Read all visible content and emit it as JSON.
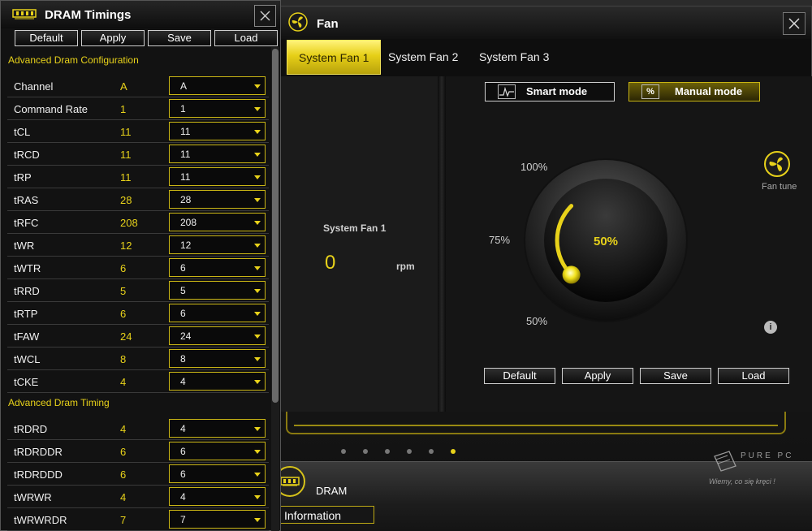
{
  "dram_window": {
    "title": "DRAM Timings",
    "buttons": {
      "default": "Default",
      "apply": "Apply",
      "save": "Save",
      "load": "Load"
    },
    "section_config": "Advanced Dram Configuration",
    "section_timing": "Advanced Dram Timing",
    "config_rows": [
      {
        "name": "Channel",
        "value": "A",
        "selected": "A"
      },
      {
        "name": "Command Rate",
        "value": "1",
        "selected": "1"
      },
      {
        "name": "tCL",
        "value": "11",
        "selected": "11"
      },
      {
        "name": "tRCD",
        "value": "11",
        "selected": "11"
      },
      {
        "name": "tRP",
        "value": "11",
        "selected": "11"
      },
      {
        "name": "tRAS",
        "value": "28",
        "selected": "28"
      },
      {
        "name": "tRFC",
        "value": "208",
        "selected": "208"
      },
      {
        "name": "tWR",
        "value": "12",
        "selected": "12"
      },
      {
        "name": "tWTR",
        "value": "6",
        "selected": "6"
      },
      {
        "name": "tRRD",
        "value": "5",
        "selected": "5"
      },
      {
        "name": "tRTP",
        "value": "6",
        "selected": "6"
      },
      {
        "name": "tFAW",
        "value": "24",
        "selected": "24"
      },
      {
        "name": "tWCL",
        "value": "8",
        "selected": "8"
      },
      {
        "name": "tCKE",
        "value": "4",
        "selected": "4"
      }
    ],
    "timing_rows": [
      {
        "name": "tRDRD",
        "value": "4",
        "selected": "4"
      },
      {
        "name": "tRDRDDR",
        "value": "6",
        "selected": "6"
      },
      {
        "name": "tRDRDDD",
        "value": "6",
        "selected": "6"
      },
      {
        "name": "tWRWR",
        "value": "4",
        "selected": "4"
      },
      {
        "name": "tWRWRDR",
        "value": "7",
        "selected": "7"
      }
    ]
  },
  "fan_window": {
    "title": "Fan",
    "tabs": [
      "System Fan 1",
      "System Fan 2",
      "System Fan 3"
    ],
    "active_tab": 0,
    "fan_name": "System Fan 1",
    "rpm_value": "0",
    "rpm_unit": "rpm",
    "modes": {
      "smart": "Smart mode",
      "manual": "Manual mode",
      "manual_icon": "%"
    },
    "active_mode": "manual",
    "fan_tune_label": "Fan tune",
    "info_icon": "i",
    "dial": {
      "value_label": "50%",
      "tick_100": "100%",
      "tick_75": "75%",
      "tick_50": "50%",
      "level_percent": 50
    },
    "buttons": {
      "default": "Default",
      "apply": "Apply",
      "save": "Save",
      "load": "Load"
    }
  },
  "background": {
    "dram_tile_label": "DRAM",
    "info_tab_label": "Information",
    "pager_dot_count": 6,
    "pager_active_index": 5,
    "watermark_line1": "PURE PC",
    "watermark_line2": "Wiemy, co się kręci !"
  },
  "colors": {
    "accent": "#e8d21a",
    "panel": "#141414",
    "border_gold": "#c9b515"
  }
}
